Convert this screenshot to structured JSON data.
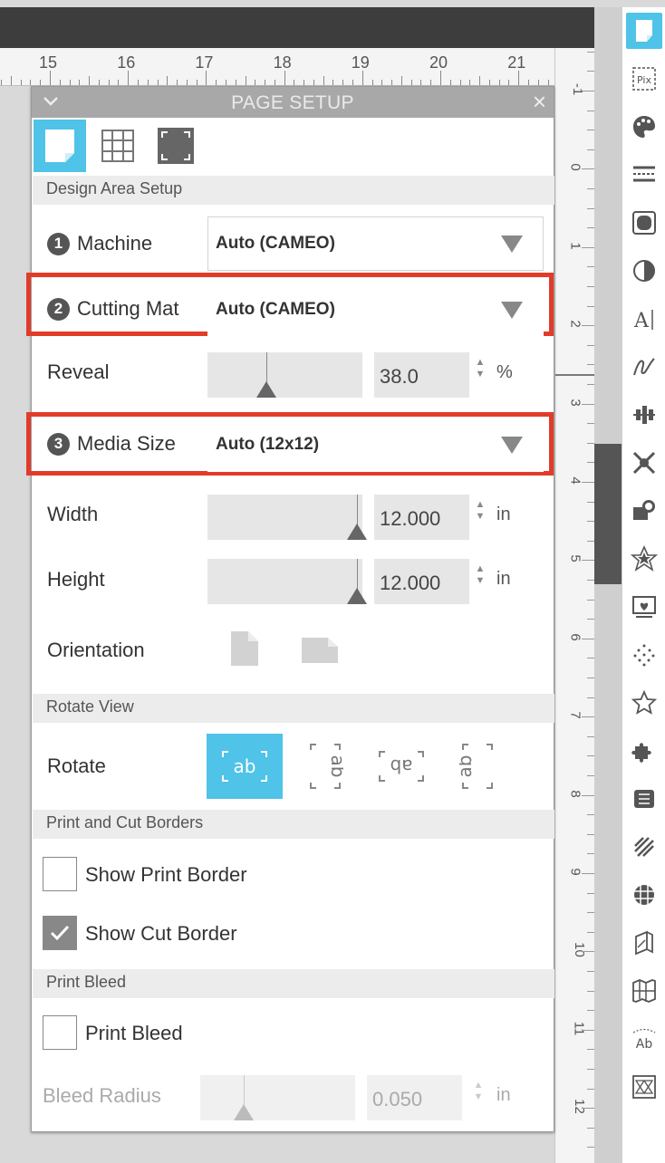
{
  "ruler": {
    "x_labels": [
      "15",
      "16",
      "17",
      "18",
      "19",
      "20",
      "21"
    ],
    "y_labels": [
      "-1",
      "0",
      "1",
      "2",
      "3",
      "4",
      "5",
      "6",
      "7",
      "8",
      "9",
      "10",
      "11",
      "12"
    ]
  },
  "panel": {
    "title": "PAGE SETUP",
    "close": "×",
    "sections": {
      "design_area": "Design Area Setup",
      "rotate_view": "Rotate View",
      "print_cut_borders": "Print and Cut Borders",
      "print_bleed": "Print Bleed"
    },
    "machine": {
      "step": "1",
      "label": "Machine",
      "value": "Auto (CAMEO)"
    },
    "cutting_mat": {
      "step": "2",
      "label": "Cutting Mat",
      "value": "Auto (CAMEO)"
    },
    "reveal": {
      "label": "Reveal",
      "value": "38.0",
      "unit": "%",
      "level": 0.38
    },
    "media_size": {
      "step": "3",
      "label": "Media Size",
      "value": "Auto (12x12)"
    },
    "width": {
      "label": "Width",
      "value": "12.000",
      "unit": "in"
    },
    "height": {
      "label": "Height",
      "value": "12.000",
      "unit": "in"
    },
    "orientation": {
      "label": "Orientation"
    },
    "rotate": {
      "label": "Rotate",
      "options": [
        "ab",
        "ab",
        "ab",
        "ab"
      ]
    },
    "show_print_border": {
      "label": "Show Print Border",
      "checked": false
    },
    "show_cut_border": {
      "label": "Show Cut Border",
      "checked": true
    },
    "print_bleed": {
      "label": "Print Bleed",
      "checked": false
    },
    "bleed_radius": {
      "label": "Bleed Radius",
      "value": "0.050",
      "unit": "in"
    }
  },
  "toolbar": {
    "icons": [
      "page-setup-icon",
      "pixscan-icon",
      "fill-palette-icon",
      "line-style-icon",
      "image-effects-icon",
      "contrast-icon",
      "text-style-icon",
      "sketch-icon",
      "align-icon",
      "replicate-icon",
      "modify-icon",
      "offset-icon",
      "trace-icon",
      "design-store-icon",
      "star-icon",
      "puzzle-icon",
      "stitch-icon",
      "warp-icon",
      "grid-icon",
      "fold-icon",
      "map-icon",
      "text-to-path-icon",
      "nesting-icon"
    ],
    "pix_label": "Pix",
    "ab_label": "Ab"
  },
  "colors": {
    "accent": "#4fc3e8",
    "highlight": "#e23b2a",
    "header": "#a8a8a8"
  }
}
